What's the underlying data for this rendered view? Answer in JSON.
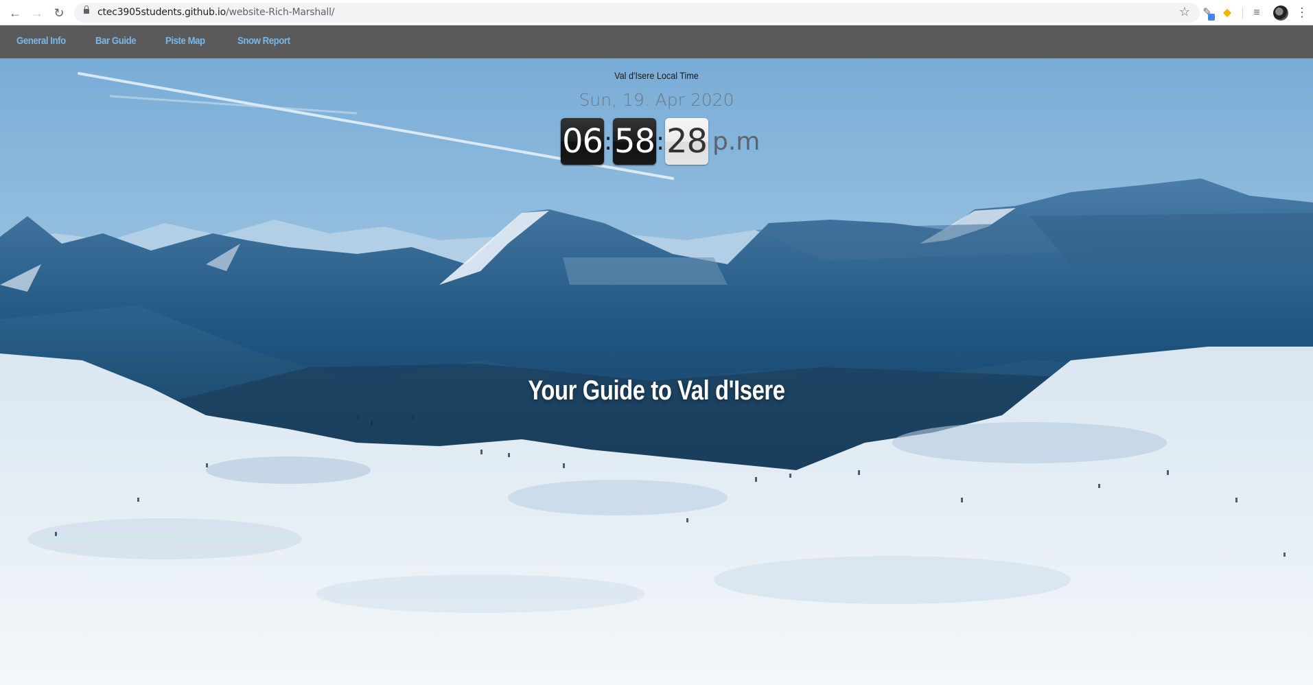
{
  "browser": {
    "url_host": "ctec3905students.github.io",
    "url_path": "/website-Rich-Marshall/",
    "back_icon": "←",
    "forward_icon": "→",
    "reload_icon": "↻",
    "star_icon": "☆",
    "menu_icon": "⋮"
  },
  "nav": {
    "items": [
      {
        "label": "General Info"
      },
      {
        "label": "Bar Guide"
      },
      {
        "label": "Piste Map"
      },
      {
        "label": "Snow Report"
      }
    ]
  },
  "clock": {
    "label": "Val d'Isere Local Time",
    "date": "Sun, 19. Apr 2020",
    "hours": "06",
    "minutes": "58",
    "seconds": "28",
    "separator": ":",
    "ampm": "p.m"
  },
  "hero": {
    "headline": "Your Guide to Val d'Isere"
  },
  "colors": {
    "nav_bg": "#5a5a5a",
    "nav_link": "#7ab6e8",
    "sky_top": "#7fb1d8",
    "mountain": "#1d4f78"
  }
}
